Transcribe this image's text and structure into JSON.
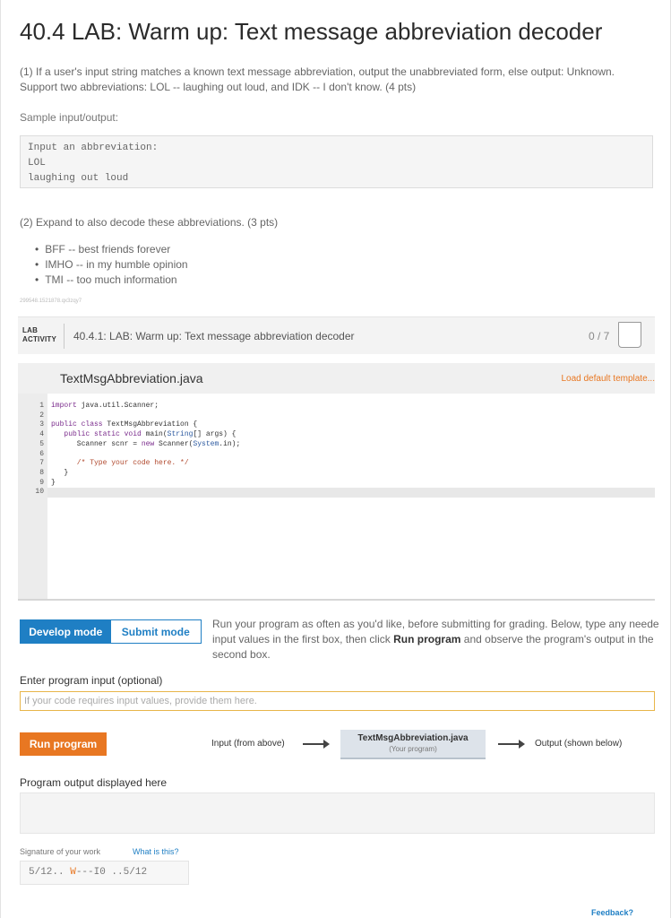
{
  "title": "40.4 LAB: Warm up: Text message abbreviation decoder",
  "part1": "(1) If a user's input string matches a known text message abbreviation, output the unabbreviated form, else output: Unknown. Support two abbreviations: LOL -- laughing out loud, and IDK -- I don't know. (4 pts)",
  "sample_label": "Sample input/output:",
  "sample_lines": [
    "Input an abbreviation:",
    "LOL",
    "laughing out loud"
  ],
  "part2": "(2) Expand to also decode these abbreviations. (3 pts)",
  "bullets": [
    "BFF -- best friends forever",
    "IMHO -- in my humble opinion",
    "TMI -- too much information"
  ],
  "tiny_id": "299548.1521878.qx3zqy7",
  "lab": {
    "tag_line1": "LAB",
    "tag_line2": "ACTIVITY",
    "title": "40.4.1: LAB: Warm up: Text message abbreviation decoder",
    "score": "0 / 7"
  },
  "editor": {
    "file_name": "TextMsgAbbreviation.java",
    "load_template": "Load default template...",
    "line_numbers": [
      "1",
      "2",
      "3",
      "4",
      "5",
      "6",
      "7",
      "8",
      "9",
      "10"
    ],
    "code": {
      "l1_kw": "import",
      "l1_rest": " java.util.Scanner;",
      "l3_kw": "public class",
      "l3_rest": " TextMsgAbbreviation {",
      "l4_kw": "   public static void",
      "l4_mid": " main(",
      "l4_type": "String",
      "l4_rest": "[] args) {",
      "l5_a": "      Scanner scnr = ",
      "l5_kw": "new",
      "l5_b": " Scanner(",
      "l5_type": "System",
      "l5_c": ".in);",
      "l7": "      /* Type your code here. */",
      "l8": "   }",
      "l9": "}"
    }
  },
  "modes": {
    "develop": "Develop mode",
    "submit": "Submit mode",
    "desc_a": "Run your program as often as you'd like, before submitting for grading. Below, type any neede",
    "desc_b": "input values in the first box, then click ",
    "desc_bold": "Run program",
    "desc_c": " and observe the program's output in the",
    "desc_d": "second box."
  },
  "input": {
    "label": "Enter program input (optional)",
    "placeholder": "If your code requires input values, provide them here."
  },
  "run": {
    "button": "Run program",
    "flow_input": "Input (from above)",
    "prog_name": "TextMsgAbbreviation.java",
    "prog_sub": "(Your program)",
    "flow_output": "Output (shown below)"
  },
  "output_label": "Program output displayed here",
  "signature": {
    "label": "Signature of your work",
    "link": "What is this?",
    "value_a": "5/12.. ",
    "value_hi": "W",
    "value_b": "---I0 ..5/12"
  },
  "feedback": "Feedback?"
}
